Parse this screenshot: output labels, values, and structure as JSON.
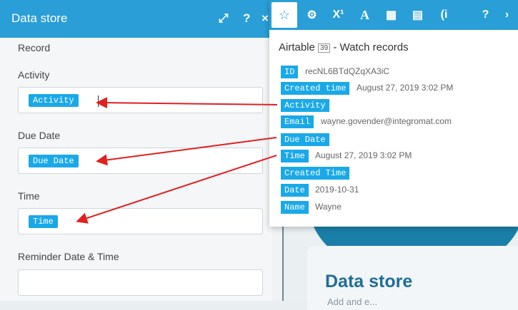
{
  "background": {
    "title": "Data store",
    "subtitle": "Add and e..."
  },
  "dialog": {
    "title": "Data store",
    "record_label": "Record",
    "fields": [
      {
        "label": "Activity",
        "token": "Activity"
      },
      {
        "label": "Due Date",
        "token": "Due Date"
      },
      {
        "label": "Time",
        "token": "Time"
      },
      {
        "label": "Reminder Date & Time",
        "token": ""
      }
    ]
  },
  "popup": {
    "toolbar": [
      "star-icon",
      "gear-icon",
      "superscript-x-icon",
      "text-a-icon",
      "calendar-icon",
      "table-icon",
      "parenthesis-i-icon",
      "help-icon"
    ],
    "title_prefix": "Airtable",
    "title_num": "39",
    "title_suffix": "- Watch records",
    "items": [
      {
        "key": "ID",
        "value": "recNL6BTdQZqXA3iC"
      },
      {
        "key": "Created time",
        "value": "August 27, 2019 3:02 PM"
      },
      {
        "key": "Activity",
        "value": ""
      },
      {
        "key": "Email",
        "value": "wayne.govender@integromat.com"
      },
      {
        "key": "Due Date",
        "value": ""
      },
      {
        "key": "Time",
        "value": "August 27, 2019 3:02 PM"
      },
      {
        "key": "Created Time",
        "value": ""
      },
      {
        "key": "Date",
        "value": "2019-10-31"
      },
      {
        "key": "Name",
        "value": "Wayne"
      }
    ]
  },
  "colors": {
    "accent": "#2a9ed6",
    "pill": "#1aa9e8",
    "arrow": "#e0201f"
  }
}
